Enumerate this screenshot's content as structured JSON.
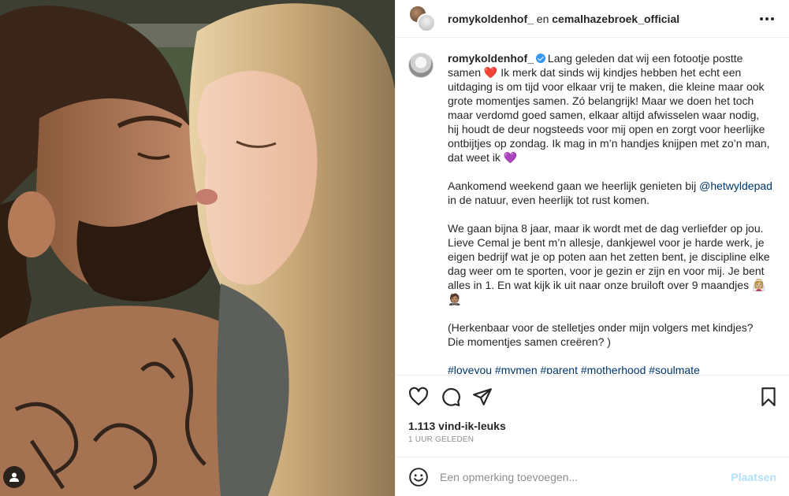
{
  "header": {
    "user1": "romykoldenhof_",
    "connector": " en ",
    "user2": "cemalhazebroek_official",
    "more_icon": "more-horizontal-icon"
  },
  "caption": {
    "username": "romykoldenhof_",
    "p1": "Lang geleden dat wij een fotootje postte samen ❤️ Ik merk dat sinds wij kindjes hebben het echt een uitdaging is om tijd voor elkaar vrij te maken, die kleine maar ook grote momentjes samen. Zó belangrijk! Maar we doen het toch maar verdomd goed samen, elkaar altijd afwisselen waar nodig, hij houdt de deur nogsteeds voor mij open en zorgt voor heerlijke ontbijtjes op zondag. Ik mag in m’n handjes knijpen met zo’n man, dat weet ik 💜",
    "p2_before": "Aankomend weekend gaan we heerlijk genieten bij ",
    "p2_mention": "@hetwyldepad",
    "p2_after": " in de natuur, even heerlijk tot rust komen.",
    "p3": "We gaan bijna 8 jaar, maar ik wordt met de dag verliefder op jou. Lieve Cemal je bent m’n allesje, dankjewel voor je harde werk, je eigen bedrijf wat je op poten aan het zetten bent, je discipline elke dag weer om te sporten, voor je gezin er zijn en voor mij. Je bent alles in 1. En wat kijk ik uit naar onze bruiloft over 9 maandjes 👰🏼‍♀️ 🤵🏽",
    "p4": "(Herkenbaar voor de stelletjes onder mijn volgers met kindjes? Die momentjes samen creëren? )",
    "tags": "#loveyou #mymen #parent #motherhood #soulmate"
  },
  "actions": {
    "like_icon": "heart-icon",
    "comment_icon": "comment-icon",
    "share_icon": "paper-plane-icon",
    "save_icon": "bookmark-icon"
  },
  "likes": "1.113 vind-ik-leuks",
  "time": "1 UUR GELEDEN",
  "comment": {
    "placeholder": "Een opmerking toevoegen...",
    "post_label": "Plaatsen",
    "emoji_icon": "smiley-icon"
  },
  "photo": {
    "user_tag_icon": "user-tag-icon"
  },
  "colors": {
    "link": "#00376b",
    "verified": "#3897f0",
    "post_disabled": "#b2dffc",
    "border": "#efefef"
  }
}
